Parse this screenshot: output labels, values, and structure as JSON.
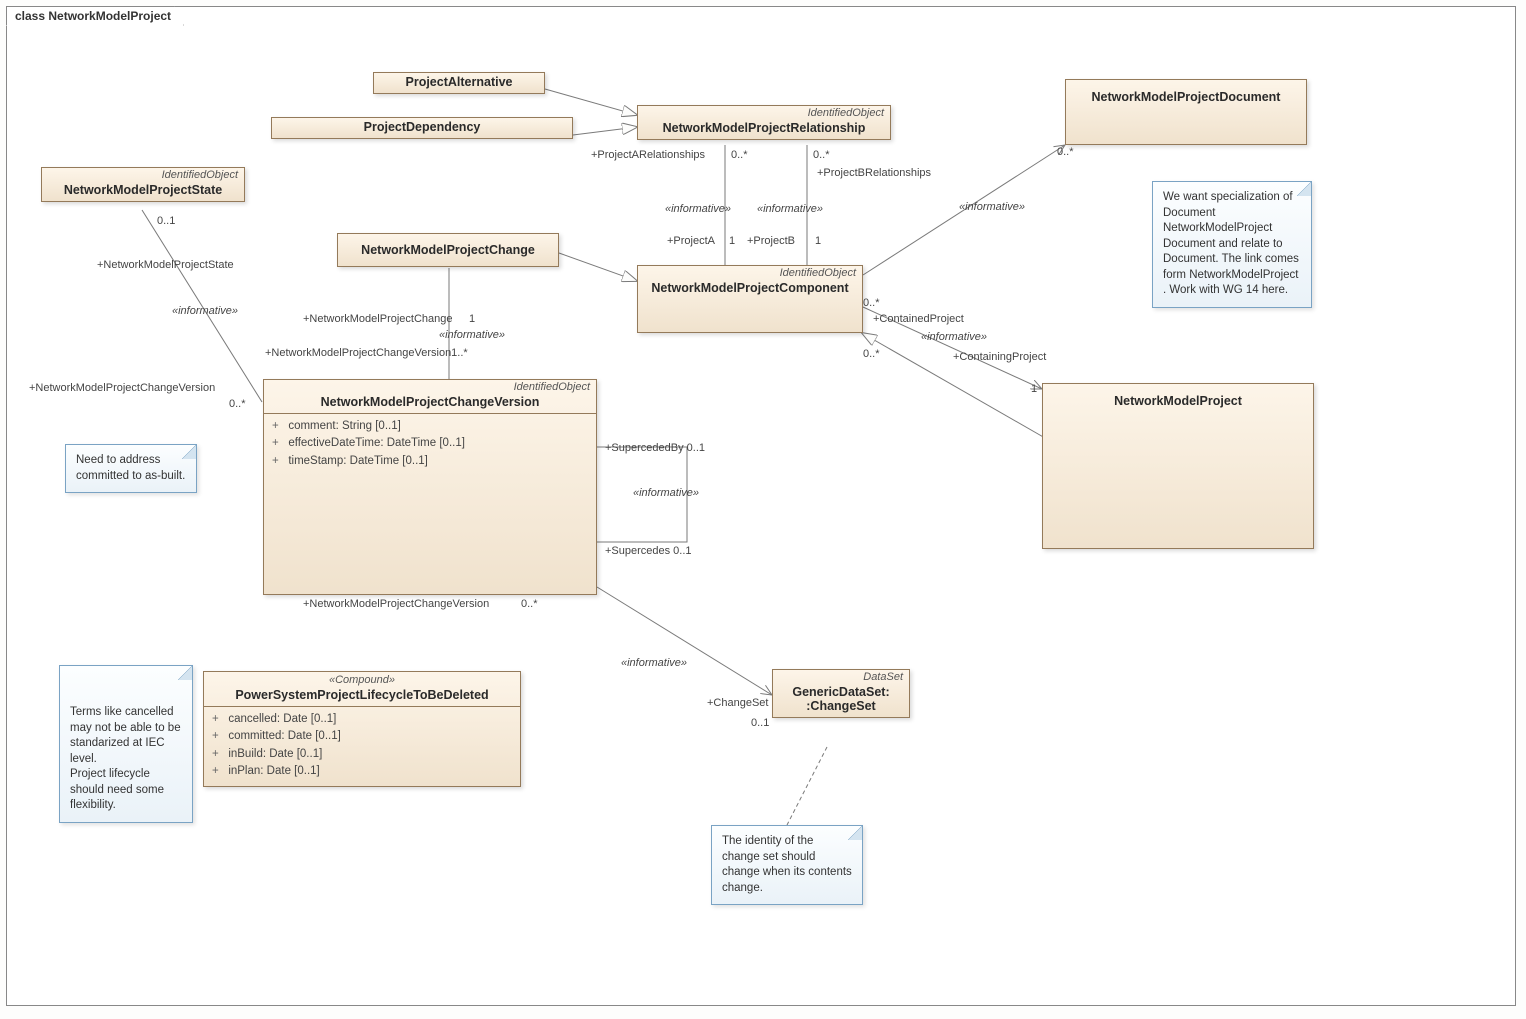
{
  "diagram_title": "class NetworkModelProject",
  "classes": {
    "projectAlternative": {
      "name": "ProjectAlternative"
    },
    "projectDependency": {
      "name": "ProjectDependency"
    },
    "relationship": {
      "stereo": "IdentifiedObject",
      "name": "NetworkModelProjectRelationship"
    },
    "document": {
      "name": "NetworkModelProjectDocument"
    },
    "state": {
      "stereo": "IdentifiedObject",
      "name": "NetworkModelProjectState"
    },
    "change": {
      "name": "NetworkModelProjectChange"
    },
    "component": {
      "stereo": "IdentifiedObject",
      "name": "NetworkModelProjectComponent"
    },
    "changeVersion": {
      "stereo": "IdentifiedObject",
      "name": "NetworkModelProjectChangeVersion",
      "attrs": [
        "comment: String [0..1]",
        "effectiveDateTime: DateTime [0..1]",
        "timeStamp: DateTime [0..1]"
      ]
    },
    "project": {
      "name": "NetworkModelProject"
    },
    "lifecycle": {
      "stereo": "«Compound»",
      "name": "PowerSystemProjectLifecycleToBeDeleted",
      "attrs": [
        "cancelled: Date [0..1]",
        "committed: Date [0..1]",
        "inBuild: Date [0..1]",
        "inPlan: Date [0..1]"
      ]
    },
    "changeSet": {
      "stereo": "DataSet",
      "name": "GenericDataSet:",
      "name2": ":ChangeSet"
    }
  },
  "notes": {
    "n1": "We want specialization of Document NetworkModelProject Document and relate to Document.     The link comes form NetworkModelProject .  Work with WG 14 here.",
    "n2": "Need to address committed to as-built.",
    "n3": "Terms like cancelled may not be able to be standarized at IEC level.\nProject lifecycle should need some flexibility.",
    "n4": "The identity of the change set should change when its contents change."
  },
  "labels": {
    "projARel": "+ProjectARelationships",
    "projBRel": "+ProjectBRelationships",
    "zeroStar": "0..*",
    "projA": "+ProjectA",
    "projB": "+ProjectB",
    "one": "1",
    "informative": "«informative»",
    "containedProj": "+ContainedProject",
    "containingProj": "+ContainingProject",
    "nmpState": "+NetworkModelProjectState",
    "zeroOne": "0..1",
    "nmpChange": "+NetworkModelProjectChange",
    "nmpChangeVer": "+NetworkModelProjectChangeVersion",
    "nmpChangeVer1star": "+NetworkModelProjectChangeVersion1..*",
    "supercededBy": "+SupercededBy 0..1",
    "supercedes": "+Supercedes 0..1",
    "changeSet": "+ChangeSet"
  }
}
